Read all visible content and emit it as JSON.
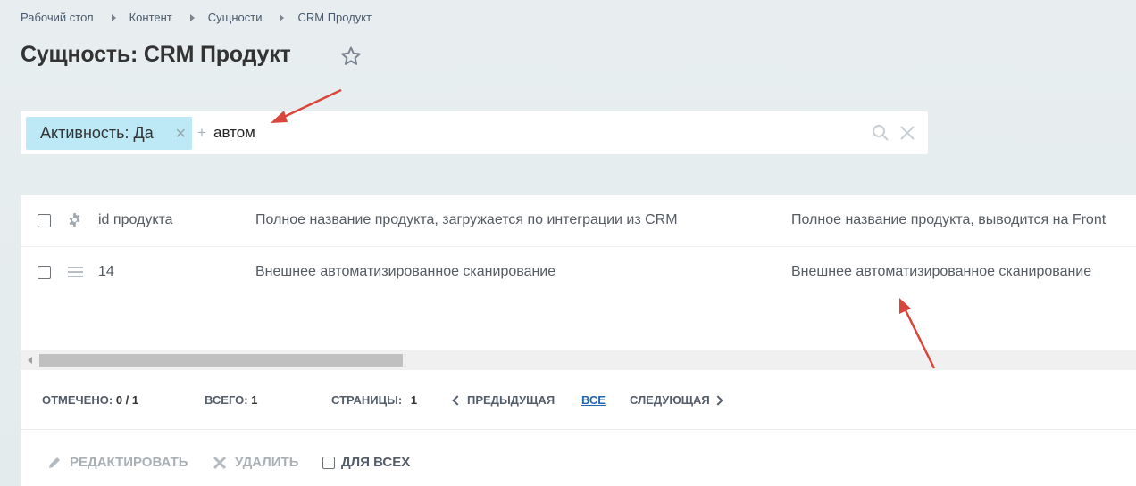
{
  "breadcrumb": [
    "Рабочий стол",
    "Контент",
    "Сущности",
    "CRM Продукт"
  ],
  "page_title": "Сущность: CRM Продукт",
  "filter": {
    "tag_label": "Активность: Да",
    "plus": "+",
    "search_text": "автом"
  },
  "grid": {
    "columns": {
      "id": "id продукта",
      "name_crm": "Полное название продукта, загружается по интеграции из CRM",
      "name_front": "Полное название продукта, выводится на Front"
    },
    "rows": [
      {
        "id": "14",
        "name_crm": "Внешнее автоматизированное сканирование",
        "name_front": "Внешнее автоматизированное сканирование"
      }
    ]
  },
  "footer": {
    "marked_label": "ОТМЕЧЕНО:",
    "marked_value": "0 / 1",
    "total_label": "ВСЕГО:",
    "total_value": "1",
    "pages_label": "СТРАНИЦЫ:",
    "pages_value": "1",
    "prev_label": "ПРЕДЫДУЩАЯ",
    "all_label": "ВСЕ",
    "next_label": "СЛЕДУЮЩАЯ"
  },
  "actions": {
    "edit_label": "РЕДАКТИРОВАТЬ",
    "delete_label": "УДАЛИТЬ",
    "for_all_label": "ДЛЯ ВСЕХ"
  },
  "colors": {
    "tag_bg": "#bde9f7",
    "link": "#2067b0",
    "annotation_arrow": "#d9463c"
  }
}
